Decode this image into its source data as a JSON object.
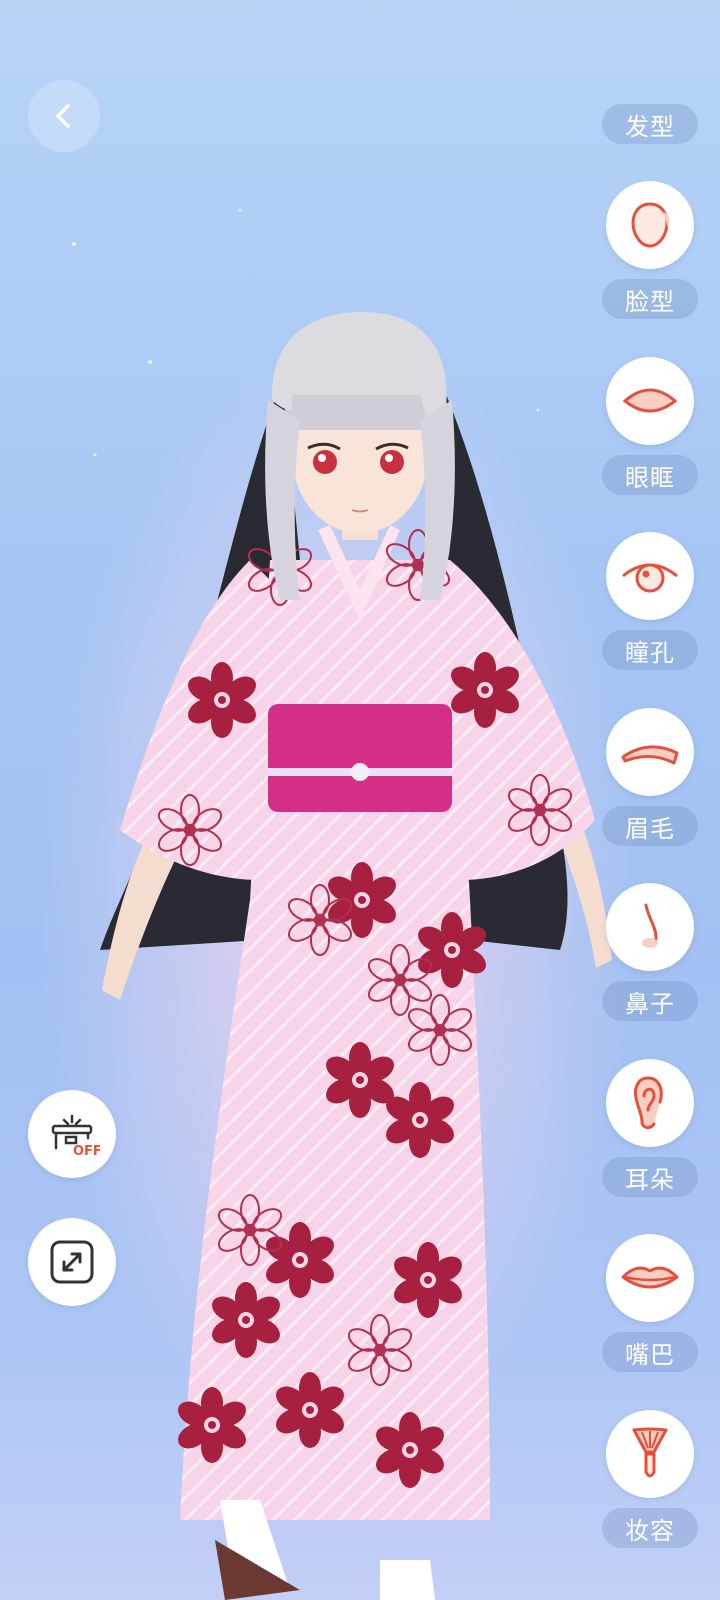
{
  "nav": {
    "back_icon": "chevron-left-icon"
  },
  "features": [
    {
      "label": "发型",
      "icon": "hair-icon"
    },
    {
      "label": "脸型",
      "icon": "face-shape-icon"
    },
    {
      "label": "眼眶",
      "icon": "eye-socket-icon"
    },
    {
      "label": "瞳孔",
      "icon": "pupil-icon"
    },
    {
      "label": "眉毛",
      "icon": "eyebrow-icon"
    },
    {
      "label": "鼻子",
      "icon": "nose-icon"
    },
    {
      "label": "耳朵",
      "icon": "ear-icon"
    },
    {
      "label": "嘴巴",
      "icon": "mouth-icon"
    },
    {
      "label": "妆容",
      "icon": "makeup-brush-icon"
    }
  ],
  "tools": {
    "background_toggle_badge": "OFF",
    "background_toggle_icon": "background-off-icon",
    "fullscreen_icon": "expand-icon"
  },
  "colors": {
    "accent": "#e5503d",
    "panel": "#ffffff"
  }
}
